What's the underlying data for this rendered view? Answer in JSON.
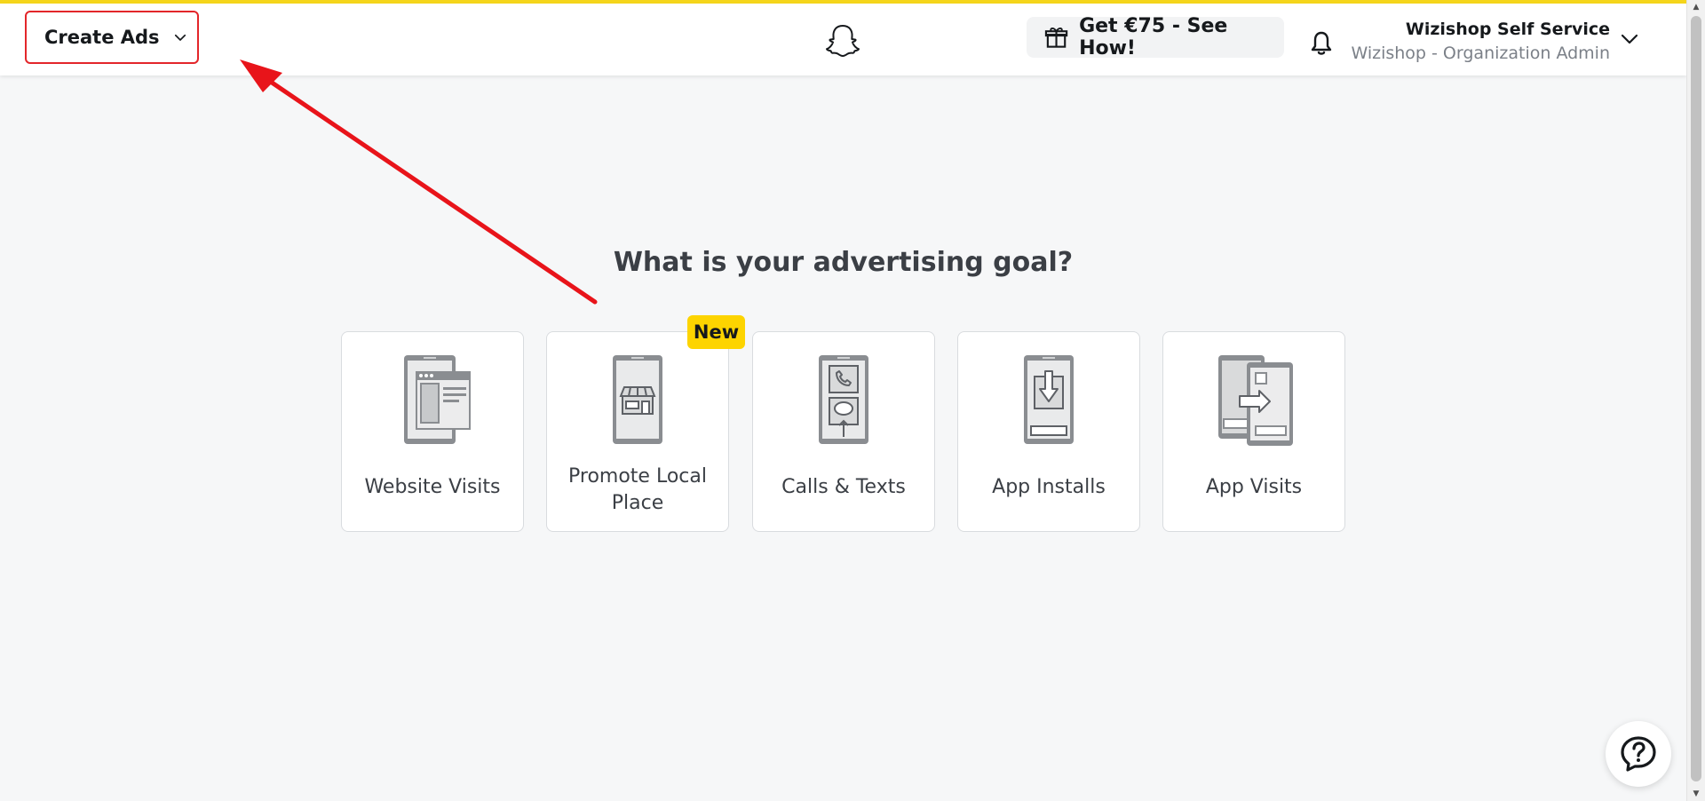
{
  "header": {
    "create_ads_label": "Create Ads",
    "promo_label": "Get €75 - See How!",
    "account_name": "Wizishop Self Service",
    "account_role": "Wizishop - Organization Admin"
  },
  "main": {
    "title": "What is your advertising goal?",
    "new_badge": "New",
    "cards": [
      {
        "label": "Website Visits",
        "icon": "website-visits-icon"
      },
      {
        "label": "Promote Local Place",
        "icon": "local-place-icon"
      },
      {
        "label": "Calls & Texts",
        "icon": "calls-texts-icon"
      },
      {
        "label": "App Installs",
        "icon": "app-installs-icon"
      },
      {
        "label": "App Visits",
        "icon": "app-visits-icon"
      }
    ]
  },
  "colors": {
    "accent": "#f5d51b",
    "highlight_box": "#e3262a",
    "badge": "#fdd400",
    "annotation_arrow": "#e8141a"
  }
}
